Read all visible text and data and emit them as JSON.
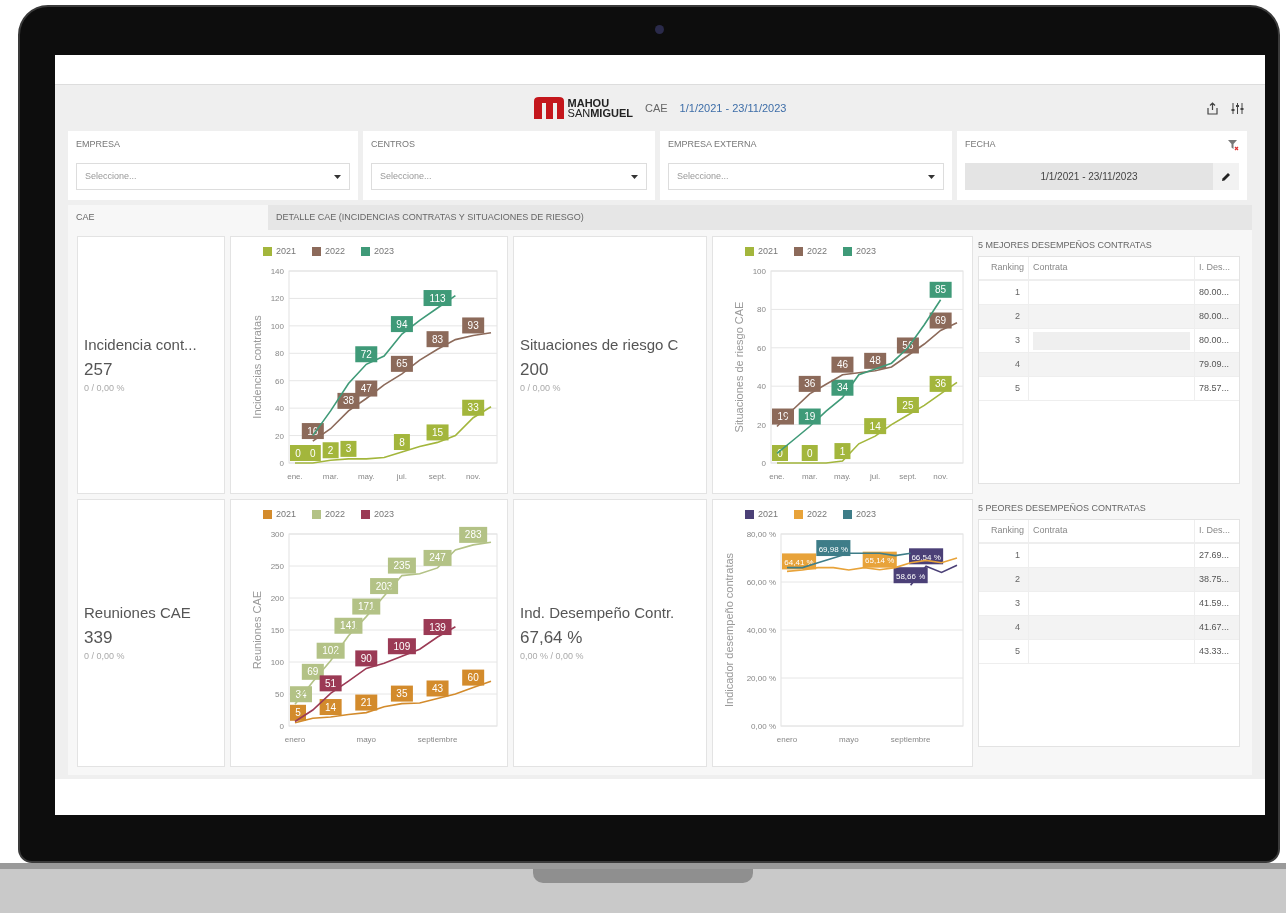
{
  "header": {
    "logo_top": "MAHOU",
    "logo_bottom": "SAN**MIGUEL**",
    "module": "CAE",
    "date_range": "1/1/2021 - 23/11/2023"
  },
  "filters": [
    {
      "kind": "select",
      "label": "EMPRESA",
      "placeholder": "Seleccione..."
    },
    {
      "kind": "select",
      "label": "CENTROS",
      "placeholder": "Seleccione..."
    },
    {
      "kind": "select",
      "label": "EMPRESA EXTERNA",
      "placeholder": "Seleccione..."
    },
    {
      "kind": "date",
      "label": "FECHA",
      "value": "1/1/2021 - 23/11/2023"
    }
  ],
  "tabs": [
    {
      "label": "CAE",
      "selected": true
    },
    {
      "label": "DETALLE CAE (INCIDENCIAS CONTRATAS Y SITUACIONES DE RIESGO)",
      "selected": false
    }
  ],
  "kpis": [
    {
      "title": "Incidencia cont...",
      "value": "257",
      "sub": "0 / 0,00 %"
    },
    {
      "title": "Situaciones de riesgo C",
      "value": "200",
      "sub": "0 / 0,00 %"
    },
    {
      "title": "Reuniones CAE",
      "value": "339",
      "sub": "0 / 0,00 %"
    },
    {
      "title": "Ind. Desempeño Contr.",
      "value": "67,64 %",
      "sub": "0,00 % / 0,00 %"
    }
  ],
  "charts": [
    {
      "chart_data": {
        "type": "line",
        "ylabel": "Incidencias contratas",
        "grid": true,
        "categories": [
          "ene.",
          null,
          "mar.",
          null,
          "may.",
          null,
          "jul.",
          null,
          "sept.",
          null,
          "nov.",
          null
        ],
        "ylim": [
          0,
          140
        ],
        "yticks": [
          0,
          20,
          40,
          60,
          80,
          100,
          120,
          140
        ],
        "series": [
          {
            "name": "2021",
            "color": "#a3b63c",
            "values": [
              0,
              0,
              2,
              3,
              3,
              4,
              8,
              12,
              15,
              20,
              33,
              41
            ],
            "value_labels": [
              "0",
              "0",
              "2",
              "3",
              null,
              null,
              "8",
              null,
              "15",
              null,
              "33",
              null
            ]
          },
          {
            "name": "2022",
            "color": "#8c6a5a",
            "values": [
              null,
              16,
              25,
              38,
              47,
              57,
              65,
              75,
              83,
              90,
              93,
              95
            ],
            "value_labels": [
              null,
              "16",
              null,
              "38",
              "47",
              null,
              "65",
              null,
              "83",
              null,
              "93",
              null
            ]
          },
          {
            "name": "2023",
            "color": "#3f9a78",
            "values": [
              null,
              20,
              38,
              58,
              72,
              78,
              94,
              104,
              113,
              122,
              null,
              null
            ],
            "value_labels": [
              null,
              null,
              null,
              null,
              "72",
              null,
              "94",
              null,
              "113",
              null,
              null,
              null
            ]
          }
        ]
      }
    },
    {
      "chart_data": {
        "type": "line",
        "ylabel": "Situaciones de riesgo CAE",
        "grid": true,
        "categories": [
          "ene.",
          null,
          "mar.",
          null,
          "may.",
          null,
          "jul.",
          null,
          "sept.",
          null,
          "nov.",
          null
        ],
        "ylim": [
          0,
          100
        ],
        "yticks": [
          0,
          20,
          40,
          60,
          80,
          100
        ],
        "series": [
          {
            "name": "2021",
            "color": "#a3b63c",
            "values": [
              0,
              0,
              0,
              0,
              1,
              10,
              14,
              20,
              25,
              30,
              36,
              42
            ],
            "value_labels": [
              "0",
              null,
              "0",
              null,
              "1",
              null,
              "14",
              null,
              "25",
              null,
              "36",
              null
            ]
          },
          {
            "name": "2022",
            "color": "#8c6a5a",
            "values": [
              19,
              28,
              36,
              41,
              46,
              47,
              48,
              50,
              56,
              62,
              69,
              73
            ],
            "value_labels": [
              "19",
              null,
              "36",
              null,
              "46",
              null,
              "48",
              null,
              "56",
              null,
              "69",
              null
            ]
          },
          {
            "name": "2023",
            "color": "#3f9a78",
            "values": [
              5,
              12,
              19,
              27,
              34,
              46,
              49,
              52,
              60,
              72,
              85,
              null
            ],
            "value_labels": [
              null,
              null,
              "19",
              null,
              "34",
              null,
              null,
              null,
              null,
              null,
              "85",
              null
            ]
          }
        ]
      }
    },
    {
      "chart_data": {
        "type": "line",
        "ylabel": "Reuniones CAE",
        "grid": true,
        "categories": [
          "enero",
          null,
          null,
          null,
          "mayo",
          null,
          null,
          null,
          "septiembre",
          null,
          null,
          null
        ],
        "ylim": [
          0,
          300
        ],
        "yticks": [
          0,
          50,
          100,
          150,
          200,
          250,
          300
        ],
        "series": [
          {
            "name": "2021",
            "color": "#d38b2c",
            "values": [
              5,
              12,
              14,
              18,
              21,
              30,
              35,
              36,
              43,
              50,
              60,
              70
            ],
            "value_labels": [
              "5",
              null,
              "14",
              null,
              "21",
              null,
              "35",
              null,
              "43",
              null,
              "60",
              null
            ]
          },
          {
            "name": "2022",
            "color": "#b3c286",
            "values": [
              34,
              69,
              102,
              141,
              171,
              203,
              235,
              238,
              247,
              275,
              283,
              287
            ],
            "value_labels": [
              "34",
              "69",
              "102",
              "141",
              "171",
              "203",
              "235",
              null,
              "247",
              null,
              "283",
              null
            ]
          },
          {
            "name": "2023",
            "color": "#9b3a55",
            "values": [
              7,
              25,
              51,
              70,
              90,
              98,
              109,
              120,
              139,
              155,
              null,
              null
            ],
            "value_labels": [
              null,
              null,
              "51",
              null,
              "90",
              null,
              "109",
              null,
              "139",
              null,
              null,
              null
            ]
          }
        ]
      }
    },
    {
      "chart_data": {
        "type": "line",
        "ylabel": "Indicador desempeño contratas",
        "grid": true,
        "categories": [
          "enero",
          null,
          null,
          null,
          "mayo",
          null,
          null,
          null,
          "septiembre",
          null,
          null,
          null
        ],
        "ylim": [
          0,
          80
        ],
        "yticks": [
          {
            "value": 0,
            "label": "0,00 %"
          },
          {
            "value": 20,
            "label": "20,00 %"
          },
          {
            "value": 40,
            "label": "40,00 %"
          },
          {
            "value": 60,
            "label": "60,00 %"
          },
          {
            "value": 80,
            "label": "80,00 %"
          }
        ],
        "series": [
          {
            "name": "2021",
            "color": "#4b4077",
            "values": [
              null,
              null,
              null,
              null,
              null,
              null,
              null,
              null,
              58.66,
              66.54,
              64,
              67
            ],
            "value_labels": [
              null,
              null,
              null,
              null,
              null,
              null,
              null,
              null,
              "58,66 %",
              "66,54 %",
              null,
              null
            ]
          },
          {
            "name": "2022",
            "color": "#e8a33a",
            "values": [
              64.41,
              65,
              66,
              66,
              65,
              66,
              65.14,
              66,
              68,
              69,
              68,
              70
            ],
            "value_labels": [
              "64,41 %",
              null,
              null,
              null,
              null,
              null,
              "65,14 %",
              null,
              null,
              null,
              null,
              null
            ]
          },
          {
            "name": "2023",
            "color": "#3e7d88",
            "values": [
              66,
              66,
              68,
              69.98,
              72,
              72,
              72,
              71,
              72,
              null,
              null,
              null
            ],
            "value_labels": [
              null,
              null,
              null,
              "69,98 %",
              null,
              null,
              null,
              null,
              null,
              null,
              null,
              null
            ]
          }
        ]
      }
    }
  ],
  "tables": [
    {
      "title": "5 MEJORES DESEMPEÑOS CONTRATAS",
      "columns": [
        "Ranking",
        "Contrata",
        "I. Des..."
      ],
      "rows": [
        {
          "rank": "1",
          "value": "80.00..."
        },
        {
          "rank": "2",
          "value": "80.00..."
        },
        {
          "rank": "3",
          "value": "80.00...",
          "selected": true
        },
        {
          "rank": "4",
          "value": "79.09..."
        },
        {
          "rank": "5",
          "value": "78.57..."
        }
      ]
    },
    {
      "title": "5 PEORES DESEMPEÑOS CONTRATAS",
      "columns": [
        "Ranking",
        "Contrata",
        "I. Des..."
      ],
      "rows": [
        {
          "rank": "1",
          "value": "27.69..."
        },
        {
          "rank": "2",
          "value": "38.75..."
        },
        {
          "rank": "3",
          "value": "41.59..."
        },
        {
          "rank": "4",
          "value": "41.67..."
        },
        {
          "rank": "5",
          "value": "43.33..."
        }
      ]
    }
  ]
}
